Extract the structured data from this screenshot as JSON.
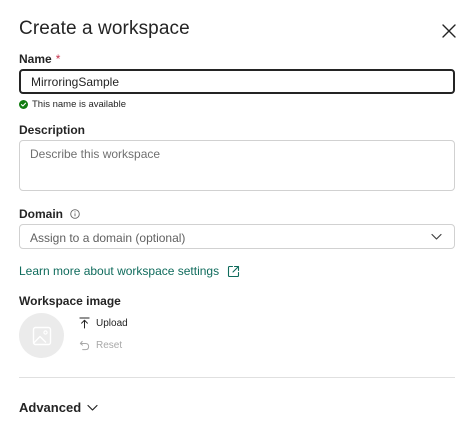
{
  "dialog": {
    "title": "Create a workspace"
  },
  "name_field": {
    "label": "Name",
    "required_mark": "*",
    "value": "MirroringSample",
    "validation_message": "This name is available",
    "validation_color": "#107c10"
  },
  "description_field": {
    "label": "Description",
    "placeholder": "Describe this workspace",
    "value": ""
  },
  "domain_field": {
    "label": "Domain",
    "placeholder": "Assign to a domain (optional)"
  },
  "learn_more": {
    "text": "Learn more about workspace settings",
    "color": "#0f6b5c"
  },
  "workspace_image": {
    "label": "Workspace image",
    "upload_label": "Upload",
    "reset_label": "Reset"
  },
  "advanced": {
    "label": "Advanced"
  },
  "icons": {
    "close": "close-icon",
    "validation": "check-circle-icon",
    "info": "info-icon",
    "chevron": "chevron-down-icon",
    "external_link": "external-link-icon",
    "image_placeholder": "image-icon",
    "upload": "upload-icon",
    "reset": "reset-icon"
  }
}
